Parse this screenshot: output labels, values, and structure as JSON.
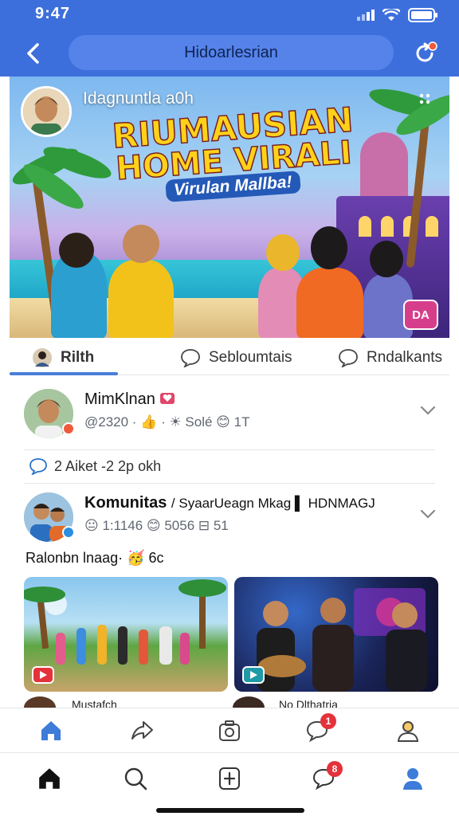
{
  "colors": {
    "primary": "#3d6fdc",
    "pill": "#5583ea",
    "tab_active": "#4a7fd9",
    "notification": "#e4323b",
    "nav_active": "#3d7cd8"
  },
  "status_bar": {
    "time": "9:47",
    "icons": [
      "signal-icon",
      "wifi-icon",
      "battery-icon"
    ]
  },
  "header": {
    "title": "Hidoarlesrian",
    "back_icon": "chevron-left-icon",
    "action_icon": "refresh-icon"
  },
  "hero": {
    "channel_name": "Idagnuntla a0h",
    "title_line1": "RIUMAUSIAN",
    "title_line2": "HOME VIRALI",
    "subtitle": "Virulan Mallba!",
    "badge": "DA"
  },
  "tabs": [
    {
      "label": "Rilth",
      "icon": "avatar",
      "active": true
    },
    {
      "label": "Sebloumtais",
      "icon": "comment-icon",
      "active": false
    },
    {
      "label": "Rndalkants",
      "icon": "comment-icon",
      "active": false
    }
  ],
  "post1": {
    "name": "MimKlnan",
    "name_icon": "heart-icon",
    "meta": "@2320 · 👍 · ☀ Solé 😊 1T",
    "chevron_icon": "chevron-down-icon"
  },
  "comment_row": {
    "text": "2 Aiket  -2 2p okh",
    "icon": "comment-icon"
  },
  "post2": {
    "name": "Komunitas",
    "name_rest": "/ SyaarUeagn Mkag ▌ HDNMAGJ",
    "meta": "😐 1:1146 😊 5056 ⊟ 51",
    "chevron_icon": "chevron-down-icon"
  },
  "caption": "Ralonbn lnaag· 🥳 6c",
  "thumbnails": [
    {
      "play_icon": "play-icon",
      "badge_color": "#e4323b"
    },
    {
      "play_icon": "play-icon",
      "badge_color": "#1f9aa6"
    }
  ],
  "peek": {
    "left": "Mustafch",
    "right": "No Dlthatria"
  },
  "nav_bar_1": [
    {
      "icon": "home-icon",
      "active": true
    },
    {
      "icon": "share-icon",
      "active": false
    },
    {
      "icon": "camera-icon",
      "active": false
    },
    {
      "icon": "chat-icon",
      "badge": "1",
      "active": false
    },
    {
      "icon": "profile-icon",
      "active": false
    }
  ],
  "nav_bar_2": [
    {
      "icon": "home-icon",
      "active": true
    },
    {
      "icon": "search-icon",
      "active": false
    },
    {
      "icon": "add-icon",
      "active": false
    },
    {
      "icon": "chat-icon",
      "badge": "8",
      "active": false
    },
    {
      "icon": "profile-icon",
      "active": true
    }
  ]
}
